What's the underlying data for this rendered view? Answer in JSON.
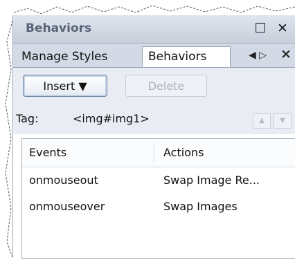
{
  "panel": {
    "title": "Behaviors",
    "maximize_icon": "maximize-icon",
    "close_icon": "close-icon"
  },
  "tabs": [
    {
      "label": "Manage Styles",
      "active": false
    },
    {
      "label": "Behaviors",
      "active": true
    }
  ],
  "tab_nav": {
    "glyph": "◀ ▷",
    "close": "×"
  },
  "toolbar": {
    "insert_label": "Insert ▼",
    "delete_label": "Delete"
  },
  "tag": {
    "label": "Tag:",
    "value": "<img#img1>"
  },
  "table": {
    "headers": [
      "Events",
      "Actions"
    ],
    "rows": [
      {
        "event": "onmouseout",
        "action": "Swap Image Re..."
      },
      {
        "event": "onmouseover",
        "action": "Swap Images"
      }
    ]
  },
  "colors": {
    "titlebar": "#c7cfdb",
    "toolbar": "#e9edf3",
    "border": "#97a3b5"
  }
}
